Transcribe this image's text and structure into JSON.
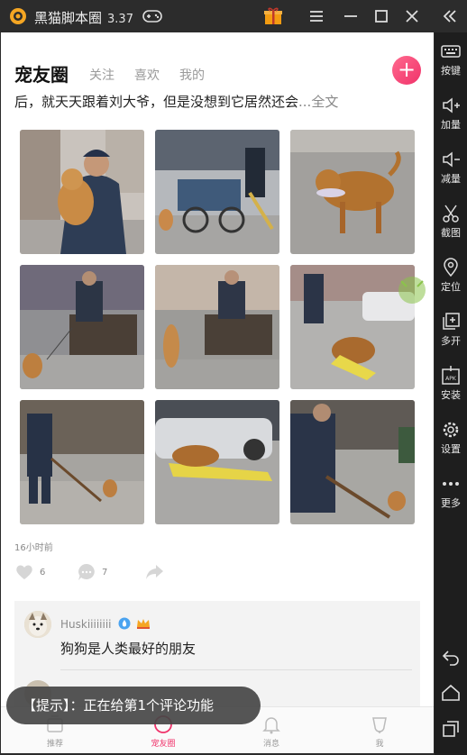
{
  "emulator": {
    "title": "黑猫脚本圈",
    "version": "3.37"
  },
  "sidebar": {
    "items": [
      {
        "label": "按键",
        "icon": "keyboard-icon"
      },
      {
        "label": "加量",
        "icon": "volume-up-icon"
      },
      {
        "label": "减量",
        "icon": "volume-down-icon"
      },
      {
        "label": "截图",
        "icon": "scissors-icon"
      },
      {
        "label": "定位",
        "icon": "location-pin-icon"
      },
      {
        "label": "多开",
        "icon": "multi-instance-icon"
      },
      {
        "label": "安装",
        "icon": "apk-install-icon"
      },
      {
        "label": "设置",
        "icon": "gear-icon"
      },
      {
        "label": "更多",
        "icon": "more-dots-icon"
      }
    ]
  },
  "header": {
    "title": "宠友圈",
    "tabs": [
      "关注",
      "喜欢",
      "我的"
    ]
  },
  "post": {
    "text": "后，就天天跟着刘大爷，但是没想到它居然还会",
    "more": "...全文",
    "time": "16小时前",
    "likes": "6",
    "comments": "7"
  },
  "comment": {
    "username": "Huskiiiiiiii",
    "text": "狗狗是人类最好的朋友"
  },
  "toast": {
    "text": "【提示】：正在给第1个评论功能"
  },
  "bottom_nav": {
    "items": [
      "推荐",
      "宠友圈",
      "消息",
      "我"
    ]
  },
  "colors": {
    "accent": "#f0326a",
    "emulator_bg": "#2c2c2c"
  }
}
